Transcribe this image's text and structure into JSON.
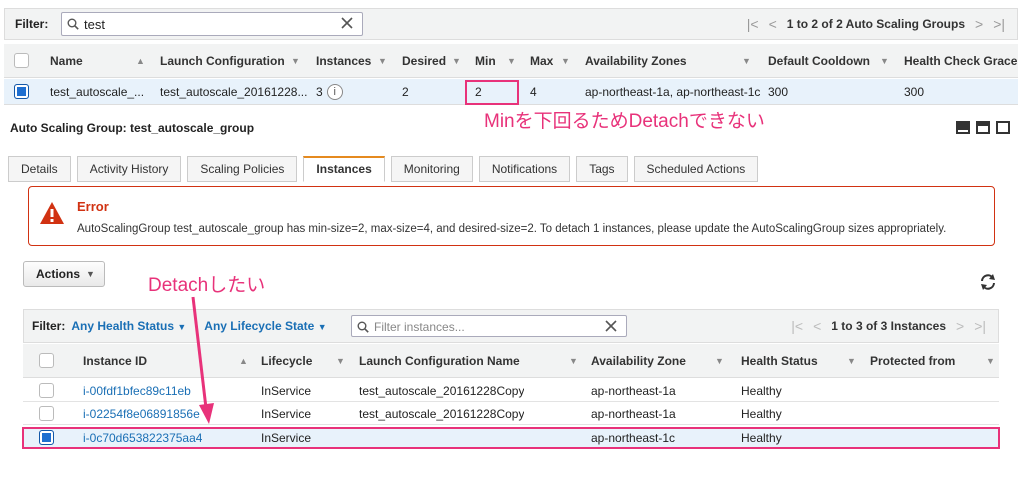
{
  "asg": {
    "filter_label": "Filter:",
    "search_value": "test",
    "pager_text": "1 to 2 of 2 Auto Scaling Groups",
    "columns": [
      "Name",
      "Launch Configuration",
      "Instances",
      "Desired",
      "Min",
      "Max",
      "Availability Zones",
      "Default Cooldown",
      "Health Check Grace"
    ],
    "row": {
      "name": "test_autoscale_...",
      "launch_config": "test_autoscale_20161228...",
      "instances": "3",
      "desired": "2",
      "min": "2",
      "max": "4",
      "zones": "ap-northeast-1a, ap-northeast-1c",
      "cooldown": "300",
      "grace": "300"
    }
  },
  "annotations": {
    "note_min": "Minを下回るためDetachできない",
    "note_detach": "Detachしたい",
    "highlight_color": "#e8327a"
  },
  "detail": {
    "title": "Auto Scaling Group: test_autoscale_group",
    "tabs": [
      "Details",
      "Activity History",
      "Scaling Policies",
      "Instances",
      "Monitoring",
      "Notifications",
      "Tags",
      "Scheduled Actions"
    ],
    "active_tab": "Instances"
  },
  "error": {
    "title": "Error",
    "message": "AutoScalingGroup test_autoscale_group has min-size=2, max-size=4, and desired-size=2. To detach 1 instances, please update the AutoScalingGroup sizes appropriately."
  },
  "instances": {
    "actions_label": "Actions",
    "filter_label": "Filter:",
    "health_filter": "Any Health Status",
    "lifecycle_filter": "Any Lifecycle State",
    "search_placeholder": "Filter instances...",
    "pager_text": "1 to 3 of 3 Instances",
    "columns": [
      "Instance ID",
      "Lifecycle",
      "Launch Configuration Name",
      "Availability Zone",
      "Health Status",
      "Protected from"
    ],
    "rows": [
      {
        "id": "i-00fdf1bfec89c11eb",
        "lifecycle": "InService",
        "lc": "test_autoscale_20161228Copy",
        "az": "ap-northeast-1a",
        "health": "Healthy",
        "selected": false
      },
      {
        "id": "i-02254f8e06891856e",
        "lifecycle": "InService",
        "lc": "test_autoscale_20161228Copy",
        "az": "ap-northeast-1a",
        "health": "Healthy",
        "selected": false
      },
      {
        "id": "i-0c70d653822375aa4",
        "lifecycle": "InService",
        "lc": "",
        "az": "ap-northeast-1c",
        "health": "Healthy",
        "selected": true
      }
    ]
  },
  "colors": {
    "accent": "#1f6fd0",
    "error": "#d13212",
    "link": "#1a6fb5",
    "tab_active": "#e58a1f"
  }
}
